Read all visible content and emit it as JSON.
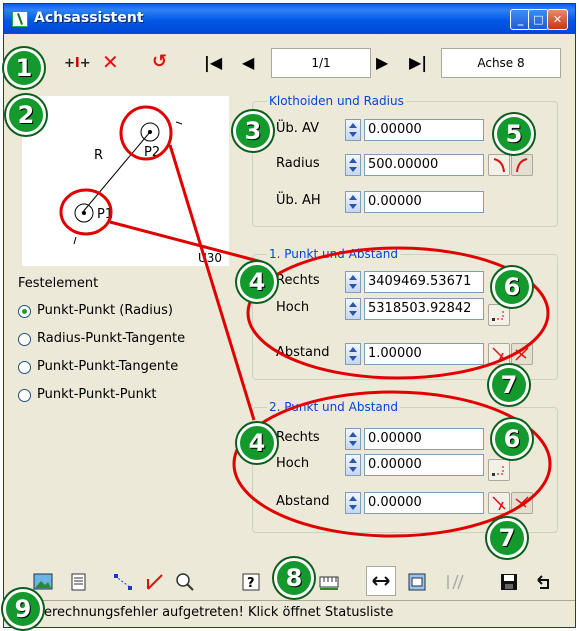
{
  "window": {
    "title": "Achsassistent",
    "min": "_",
    "max": "□",
    "close": "✕"
  },
  "toolbar": {
    "icons": [
      "insert-element-icon",
      "split-icon",
      "delete-icon",
      "reverse-icon",
      "first-icon",
      "previous-icon",
      "next-icon",
      "last-icon"
    ],
    "page_counter": "1/1",
    "axis_name": "Achse 8"
  },
  "preview": {
    "label_r": "R",
    "label_p1": "P1",
    "label_p2": "P2",
    "label_code": "U30"
  },
  "clothoid_group": {
    "title": "Klothoiden und Radius",
    "rows": [
      {
        "label": "Üb. AV",
        "value": "0.00000"
      },
      {
        "label": "Radius",
        "value": "500.00000"
      },
      {
        "label": "Üb. AH",
        "value": "0.00000"
      }
    ]
  },
  "fixed_element": {
    "title": "Festelement",
    "options": [
      "Punkt-Punkt (Radius)",
      "Radius-Punkt-Tangente",
      "Punkt-Punkt-Tangente",
      "Punkt-Punkt-Punkt"
    ],
    "selected": "Punkt-Punkt (Radius)"
  },
  "point1": {
    "title": "1. Punkt und Abstand",
    "right_label": "Rechts",
    "right_value": "3409469.53671",
    "high_label": "Hoch",
    "high_value": "5318503.92842",
    "distance_label": "Abstand",
    "distance_value": "1.00000"
  },
  "point2": {
    "title": "2. Punkt und Abstand",
    "right_label": "Rechts",
    "right_value": "0.00000",
    "high_label": "Hoch",
    "high_value": "0.00000",
    "distance_label": "Abstand",
    "distance_value": "0.00000"
  },
  "callouts": [
    "1",
    "2",
    "3",
    "4",
    "4",
    "5",
    "6",
    "6",
    "7",
    "7",
    "8",
    "9"
  ],
  "bottom_toolbar": {
    "icons": [
      "image-icon",
      "document-icon",
      "points-icon",
      "angle-icon",
      "zoom-icon",
      "help-icon",
      "ruler-icon",
      "arrows-icon",
      "screen-icon",
      "parallel-icon",
      "save-icon",
      "undo-icon"
    ]
  },
  "status": {
    "text": "erechnungsfehler aufgetreten! Klick öffnet Statusliste"
  },
  "colors": {
    "accent": "#0046D5",
    "callout": "#149A2C",
    "annotation": "#E00000"
  }
}
